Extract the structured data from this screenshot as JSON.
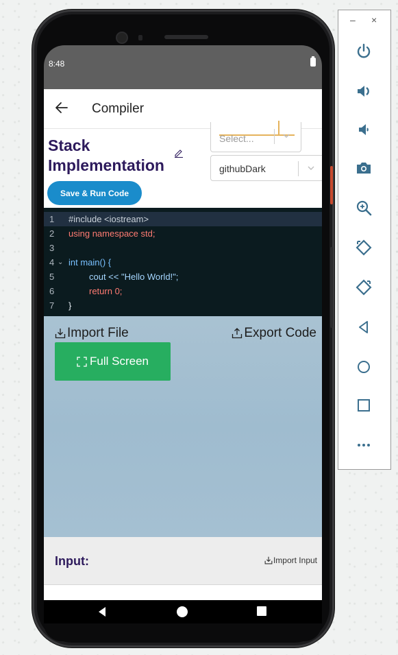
{
  "status_bar": {
    "time": "8:48"
  },
  "app_bar": {
    "title": "Compiler"
  },
  "header": {
    "title": "Stack Implementation",
    "language_select": {
      "placeholder": "Select..."
    },
    "theme_select": {
      "value": "githubDark"
    },
    "run_button": "Save & Run Code"
  },
  "editor": {
    "lines": [
      {
        "num": "1",
        "text": "#include <iostream>"
      },
      {
        "num": "2",
        "text": "using namespace std;"
      },
      {
        "num": "3",
        "text": ""
      },
      {
        "num": "4",
        "text": "int main() {"
      },
      {
        "num": "5",
        "text": "cout << \"Hello World!\";"
      },
      {
        "num": "6",
        "text": "return 0;"
      },
      {
        "num": "7",
        "text": "}"
      }
    ],
    "fold_marker": "⌄"
  },
  "actions": {
    "import_file": "Import File",
    "export_code": "Export Code",
    "full_screen": "Full Screen"
  },
  "input_section": {
    "label": "Input:",
    "import_input": "Import Input"
  },
  "emulator_panel": {
    "minimize": "–",
    "close": "×",
    "buttons": [
      "power-icon",
      "volume-up-icon",
      "volume-down-icon",
      "camera-icon",
      "zoom-icon",
      "rotate-left-icon",
      "rotate-right-icon",
      "back-icon",
      "home-icon",
      "overview-icon",
      "more-icon"
    ]
  },
  "colors": {
    "title": "#2d1a5c",
    "run_button": "#1a8ccb",
    "full_screen_button": "#27ae60",
    "editor_bg": "#0b1b1f",
    "emulator_icon": "#3b6f8e"
  }
}
